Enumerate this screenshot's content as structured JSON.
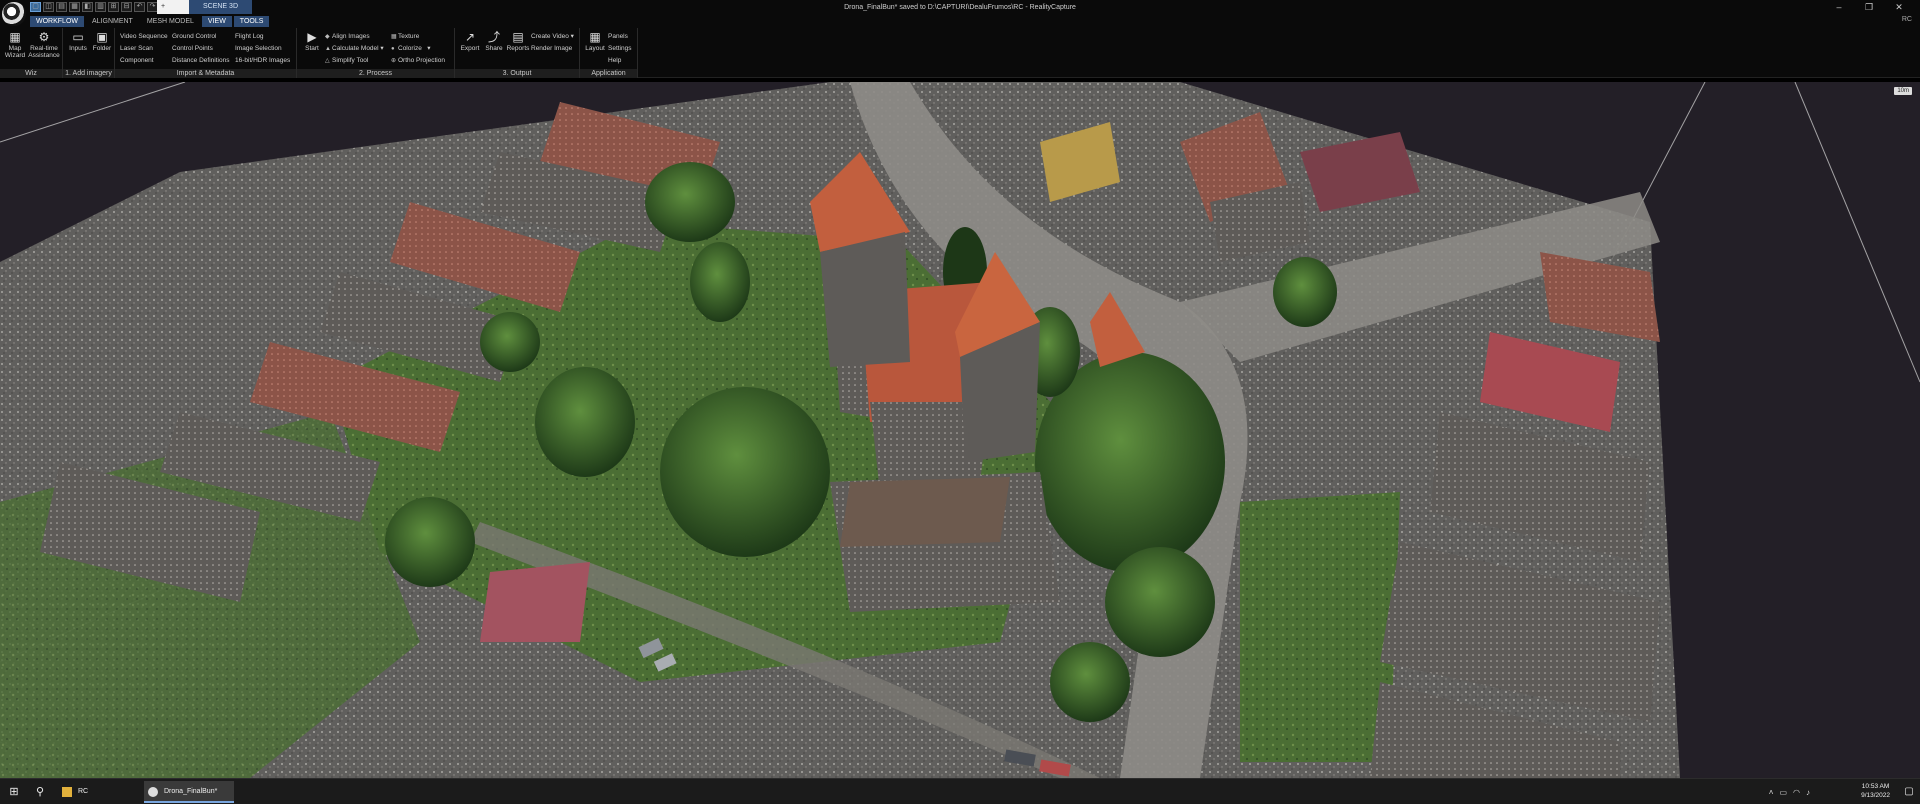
{
  "window": {
    "title": "Drona_FinalBun* saved to D:\\CAPTURI\\DealuFrumos\\RC - RealityCapture",
    "minimize": "–",
    "restore": "❐",
    "close": "✕"
  },
  "doc_tabs": {
    "new_tab": "+",
    "scene": "SCENE 3D"
  },
  "menu_tabs": [
    "WORKFLOW",
    "ALIGNMENT",
    "MESH MODEL",
    "VIEW",
    "TOOLS"
  ],
  "rc_badge": "RC",
  "ribbon": {
    "wiz": {
      "label": "Wiz",
      "map_wizard": "Map Wizard",
      "realtime": "Real-time Assistance"
    },
    "add_imagery": {
      "label": "1. Add imagery",
      "inputs": "Inputs",
      "folder": "Folder"
    },
    "import": {
      "label": "Import & Metadata",
      "items": [
        "Video Sequence",
        "Laser Scan",
        "Component",
        "Ground Control",
        "Control Points",
        "Distance Definitions",
        "Flight Log",
        "Image Selection",
        "16-bit/HDR Images"
      ]
    },
    "process": {
      "label": "2. Process",
      "start": "Start",
      "items": [
        "Align Images",
        "Calculate Model",
        "Simplify Tool",
        "Texture",
        "Colorize",
        "Ortho Projection"
      ]
    },
    "output": {
      "label": "3. Output",
      "export": "Export",
      "share": "Share",
      "reports": "Reports",
      "items": [
        "Create Video",
        "Render Image"
      ]
    },
    "application": {
      "label": "Application",
      "layout": "Layout",
      "items": [
        "Panels",
        "Settings",
        "Help"
      ]
    }
  },
  "viewport": {
    "scale_badge": "10m"
  },
  "taskbar": {
    "apps": [
      {
        "label": "RC"
      },
      {
        "label": "Drona_FinalBun* save..."
      }
    ],
    "time": "10:53 AM",
    "date": "9/13/2022"
  },
  "colors": {
    "accent": "#2d4a73",
    "roof": "#c0593a",
    "foliage": "#3c6a2e"
  }
}
